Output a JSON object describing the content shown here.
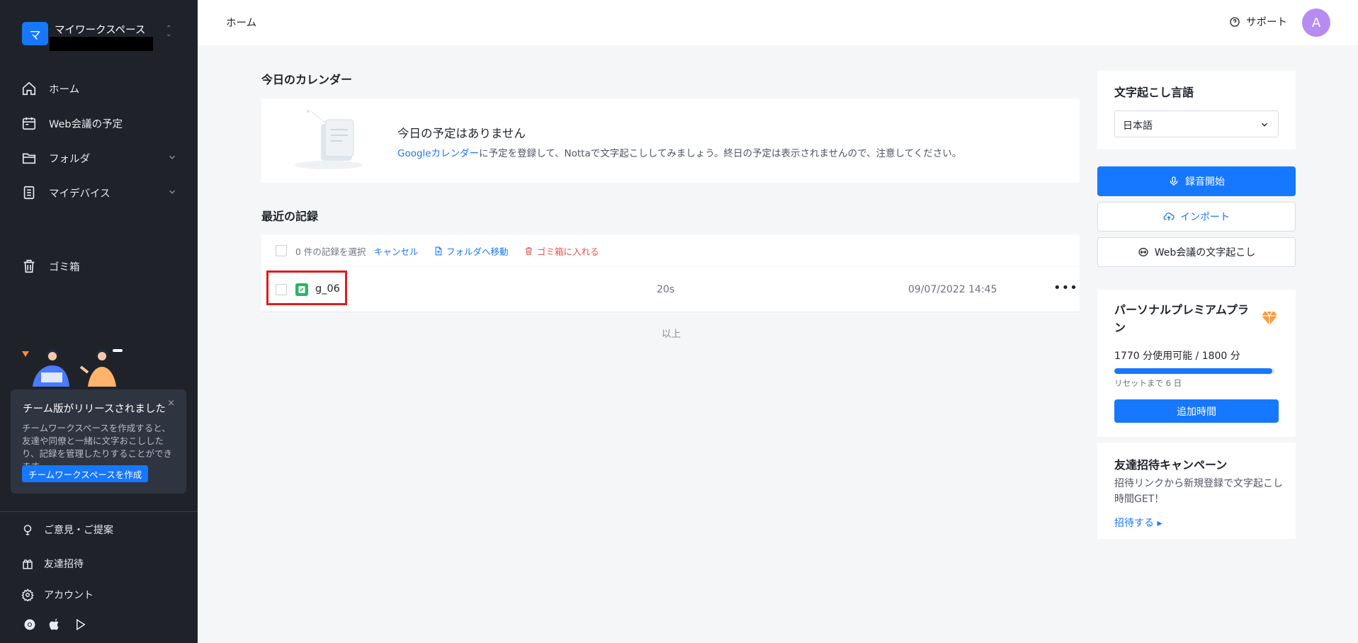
{
  "workspace": {
    "avatar_letter": "マ",
    "name": "マイワークスペース"
  },
  "sidebar": {
    "items": [
      {
        "label": "ホーム",
        "icon": "home-icon"
      },
      {
        "label": "Web会議の予定",
        "icon": "calendar-icon"
      },
      {
        "label": "フォルダ",
        "icon": "folder-icon"
      },
      {
        "label": "マイデバイス",
        "icon": "device-icon"
      },
      {
        "label": "ゴミ箱",
        "icon": "trash-icon"
      }
    ],
    "promo": {
      "title": "チーム版がリリースされました",
      "close": "×",
      "desc": "チームワークスペースを作成すると、友達や同僚と一緒に文字おこししたり、記録を管理したりすることができます。",
      "button": "チームワークスペースを作成"
    },
    "bottom": [
      {
        "label": "ご意見・ご提案",
        "icon": "lightbulb-icon"
      },
      {
        "label": "友達招待",
        "icon": "gift-icon"
      },
      {
        "label": "アカウント",
        "icon": "settings-icon"
      }
    ]
  },
  "topbar": {
    "breadcrumb": "ホーム",
    "support": "サポート",
    "user_initial": "A"
  },
  "calendar": {
    "section_title": "今日のカレンダー",
    "empty_title": "今日の予定はありません",
    "link_text": "Googleカレンダー",
    "desc_rest": "に予定を登録して、Nottaで文字起こししてみましょう。終日の予定は表示されませんので、注意してください。"
  },
  "records": {
    "section_title": "最近の記録",
    "toolbar": {
      "selected": "0 件の記録を選択",
      "cancel": "キャンセル",
      "move": "フォルダへ移動",
      "trash": "ゴミ箱に入れる"
    },
    "rows": [
      {
        "name": "g_06",
        "duration": "20s",
        "date": "09/07/2022 14:45",
        "more": "•••"
      }
    ],
    "end_text": "以上"
  },
  "right_panel": {
    "lang_title": "文字起こし言語",
    "lang_value": "日本語",
    "record_btn": "録音開始",
    "import_btn": "インポート",
    "meeting_btn": "Web会議の文字起こし",
    "plan": {
      "title": "パーソナルプレミアムプラン",
      "usage": "1770 分使用可能 / 1800 分",
      "progress": 0.983,
      "reset": "リセットまで 6 日",
      "button": "追加時間"
    },
    "invite": {
      "title": "友達招待キャンペーン",
      "desc": "招待リンクから新規登録で文字起こし時間GET！",
      "link": "招待する ▸"
    }
  },
  "colors": {
    "accent": "#1677ff",
    "sidebar_bg": "#1f2329",
    "danger": "#e8504c",
    "highlight": "#e31b1b"
  }
}
